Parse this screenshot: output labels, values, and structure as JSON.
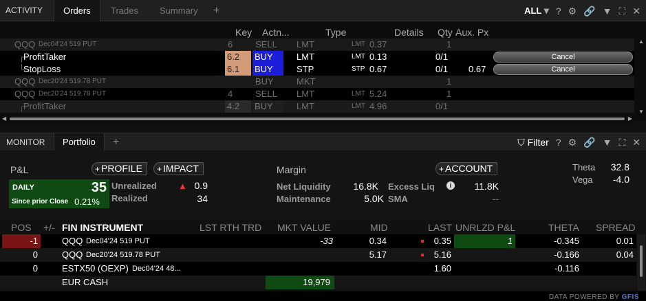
{
  "activity_panel": {
    "section_label": "ACTIVITY",
    "tabs": [
      {
        "label": "Orders",
        "active": true
      },
      {
        "label": "Trades",
        "active": false
      },
      {
        "label": "Summary",
        "active": false
      }
    ],
    "add_tab": "+",
    "filter_label": "ALL",
    "help": "?",
    "columns": {
      "key": "Key",
      "action": "Actn...",
      "type": "Type",
      "details": "Details",
      "qty": "Qty",
      "aux": "Aux. Px"
    },
    "rows": [
      {
        "name": "QQQ",
        "contract": "Dec04'24 519 PUT",
        "key": "6",
        "action": "SELL",
        "type": "LMT",
        "prefix": "LMT",
        "details": "0.37",
        "qty": "1",
        "aux": "",
        "cancel": ""
      },
      {
        "name": "ProfitTaker",
        "contract": "",
        "key": "6.2",
        "action": "BUY",
        "type": "LMT",
        "prefix": "LMT",
        "details": "0.13",
        "qty": "0/1",
        "aux": "",
        "cancel": "Cancel"
      },
      {
        "name": "StopLoss",
        "contract": "",
        "key": "6.1",
        "action": "BUY",
        "type": "STP",
        "prefix": "STP",
        "details": "0.67",
        "qty": "0/1",
        "aux": "0.67",
        "cancel": "Cancel"
      },
      {
        "name": "QQQ",
        "contract": "Dec20'24 519.78 PUT",
        "key": "",
        "action": "BUY",
        "type": "MKT",
        "prefix": "",
        "details": "",
        "qty": "1",
        "aux": "",
        "cancel": ""
      },
      {
        "name": "QQQ",
        "contract": "Dec20'24 519.78 PUT",
        "key": "4",
        "action": "SELL",
        "type": "LMT",
        "prefix": "LMT",
        "details": "5.24",
        "qty": "1",
        "aux": "",
        "cancel": ""
      },
      {
        "name": "ProfitTaker",
        "contract": "",
        "key": "4.2",
        "action": "BUY",
        "type": "LMT",
        "prefix": "LMT",
        "details": "4.96",
        "qty": "0/1",
        "aux": "",
        "cancel": ""
      }
    ]
  },
  "monitor_panel": {
    "section_label": "MONITOR",
    "tab": "Portfolio",
    "add_tab": "+",
    "filter_label": "Filter",
    "help": "?",
    "pnl": {
      "title": "P&L",
      "profile_button": "PROFILE",
      "impact_button": "IMPACT",
      "daily_label": "DAILY",
      "daily_value": "35",
      "since_label": "Since prior Close",
      "since_value": "0.21%",
      "unrealized_label": "Unrealized",
      "unrealized_value": "0.9",
      "realized_label": "Realized",
      "realized_value": "34"
    },
    "margin": {
      "title": "Margin",
      "account_button": "ACCOUNT",
      "net_liq_label": "Net Liquidity",
      "net_liq_value": "16.8K",
      "excess_label": "Excess Liq",
      "excess_value": "11.8K",
      "maint_label": "Maintenance",
      "maint_value": "5.0K",
      "sma_label": "SMA",
      "sma_value": "--"
    },
    "greeks": {
      "theta_label": "Theta",
      "theta_value": "32.8",
      "vega_label": "Vega",
      "vega_value": "-4.0"
    },
    "grid_columns": {
      "pos": "POS",
      "plusminus": "+/-",
      "instrument": "FIN INSTRUMENT",
      "last": "LST RTH TRD",
      "mkt": "MKT VALUE",
      "mid": "MID",
      "lastpx": "LAST",
      "upl": "UNRLZD P&L",
      "theta": "THETA",
      "spread": "SPREAD"
    },
    "positions": [
      {
        "pos": "-1",
        "instrument": "QQQ",
        "contract": "Dec04'24 519 PUT",
        "mkt": "-33",
        "mid": "0.34",
        "last": "0.35",
        "upl": "1",
        "theta": "-0.345",
        "spread": "0.01"
      },
      {
        "pos": "0",
        "instrument": "QQQ",
        "contract": "Dec20'24 519.78 PUT",
        "mkt": "",
        "mid": "5.17",
        "last": "5.16",
        "upl": "",
        "theta": "-0.166",
        "spread": "0.04"
      },
      {
        "pos": "0",
        "instrument": "ESTX50 (OEXP)",
        "contract": "Dec04'24 48...",
        "mkt": "",
        "mid": "",
        "last": "1.60",
        "upl": "",
        "theta": "-0.116",
        "spread": ""
      },
      {
        "pos": "",
        "instrument": "EUR CASH",
        "contract": "",
        "mkt": "19,979",
        "mid": "",
        "last": "",
        "upl": "",
        "theta": "",
        "spread": ""
      }
    ],
    "footer": "DATA POWERED BY",
    "footer_brand": "GFIS"
  }
}
